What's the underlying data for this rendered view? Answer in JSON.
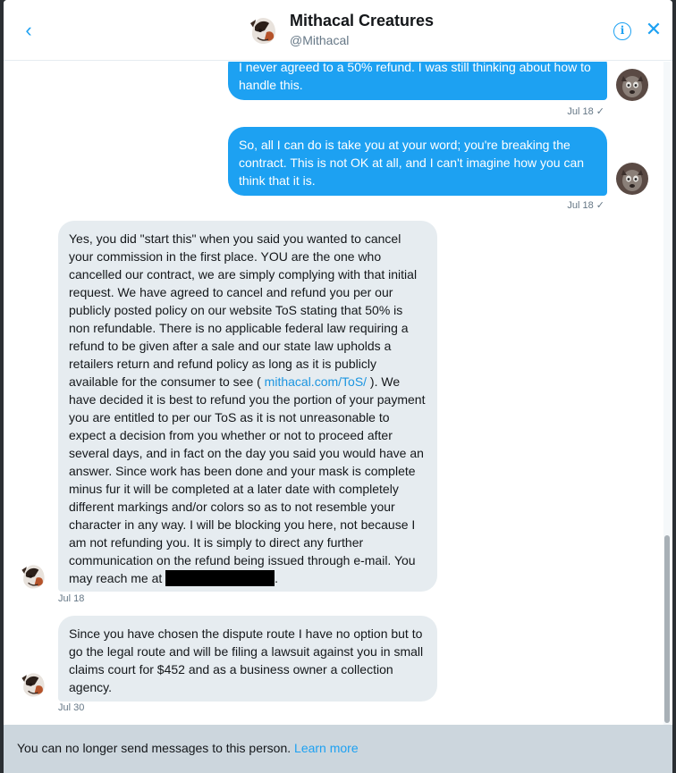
{
  "header": {
    "name": "Mithacal Creatures",
    "handle": "@Mithacal",
    "back_icon": "chevron-left-icon",
    "info_icon": "info-icon",
    "close_icon": "close-icon",
    "info_glyph": "i",
    "back_glyph": "‹",
    "close_glyph": "✕"
  },
  "messages": [
    {
      "direction": "outgoing",
      "text": "I never agreed to a 50% refund. I was still thinking about how to handle this.",
      "date": "Jul 18",
      "check": "✓"
    },
    {
      "direction": "outgoing",
      "text": "So, all I can do is take you at your word; you're breaking the contract. This is not OK at all, and I can't imagine how you can think that it is.",
      "date": "Jul 18",
      "check": "✓"
    },
    {
      "direction": "incoming",
      "text_before_link": "Yes, you did \"start this\" when you said you wanted to cancel your commission in the first place. YOU are the one who cancelled our contract, we are simply complying with that initial request.  We have agreed to cancel and refund you per our publicly posted policy on our website ToS stating that 50% is non refundable. There is no applicable federal law requiring a refund to be given after a sale and our state law upholds a retailers return and refund policy as long as it is publicly available for the consumer to see ( ",
      "link": "mithacal.com/ToS/",
      "text_after_link": " ). We have decided it is best to refund you the portion of your payment you are entitled to per our ToS as it is not unreasonable to expect a decision from you whether or not to proceed after several days, and in fact on the day you said you would have an answer. Since work has been done and your mask is complete minus fur it will be completed at a later date with completely different markings and/or colors so as to not resemble your character in any way. I will be blocking you here, not because I am not refunding you. It is simply to direct any further communication on the refund being issued through e-mail. You may reach me at ",
      "text_end": ".",
      "date": "Jul 18"
    },
    {
      "direction": "incoming",
      "text": "Since you have chosen the dispute route I have no option but to go the legal route and will be filing a lawsuit against you in small claims court for $452 and as a business owner a collection agency.",
      "date": "Jul 30"
    }
  ],
  "footer": {
    "notice": "You can no longer send messages to this person.",
    "link": "Learn more"
  },
  "colors": {
    "accent": "#1da1f2",
    "incoming_bubble": "#e6ecf0",
    "footer_bg": "#ccd6dd"
  }
}
